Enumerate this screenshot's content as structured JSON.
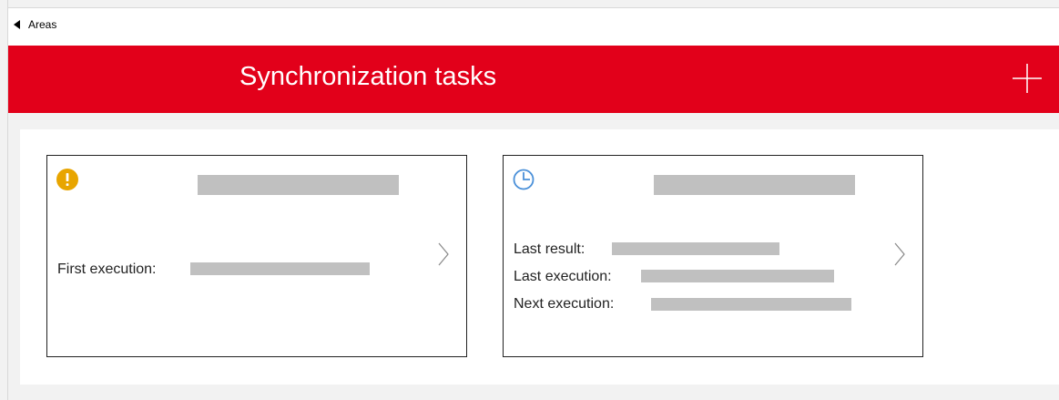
{
  "nav": {
    "back_label": "Areas"
  },
  "header": {
    "title": "Synchronization tasks",
    "add_icon": "plus-icon"
  },
  "colors": {
    "header_bg": "#e2001a",
    "warning": "#e8a500",
    "schedule": "#4a90d9",
    "redacted": "#c0c0c0"
  },
  "cards": [
    {
      "status_icon": "warning-icon",
      "fields": [
        {
          "label": "First execution:"
        }
      ]
    },
    {
      "status_icon": "clock-icon",
      "fields": [
        {
          "label": "Last result:"
        },
        {
          "label": "Last execution:"
        },
        {
          "label": "Next execution:"
        }
      ]
    }
  ]
}
